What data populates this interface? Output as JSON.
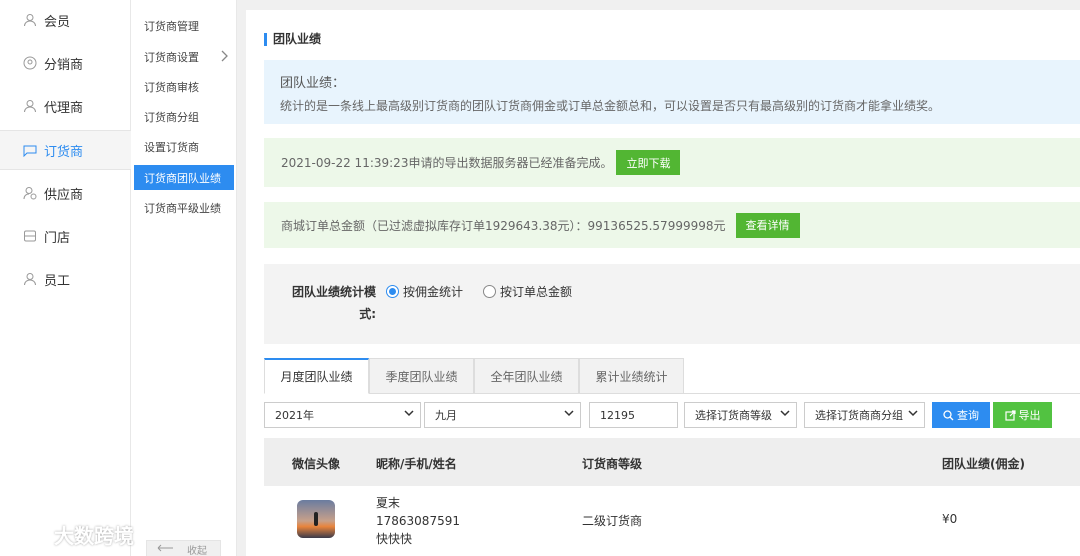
{
  "nav_primary": [
    {
      "label": "会员",
      "icon": "user-icon"
    },
    {
      "label": "分销商",
      "icon": "distributor-icon"
    },
    {
      "label": "代理商",
      "icon": "agent-icon"
    },
    {
      "label": "订货商",
      "icon": "order-icon",
      "active": true
    },
    {
      "label": "供应商",
      "icon": "supplier-icon"
    },
    {
      "label": "门店",
      "icon": "store-icon"
    },
    {
      "label": "员工",
      "icon": "staff-icon"
    }
  ],
  "nav_secondary": [
    {
      "label": "订货商管理"
    },
    {
      "label": "订货商设置",
      "has_submenu": true
    },
    {
      "label": "订货商审核"
    },
    {
      "label": "订货商分组"
    },
    {
      "label": "设置订货商"
    },
    {
      "label": "订货商团队业绩",
      "active": true
    },
    {
      "label": "订货商平级业绩"
    }
  ],
  "collapse_label": "收起",
  "page": {
    "title": "团队业绩",
    "info_title": "团队业绩：",
    "info_text": "统计的是一条线上最高级别订货商的团队订货商佣金或订单总金额总和，可以设置是否只有最高级别的订货商才能拿业绩奖。",
    "export_notice": "2021-09-22 11:39:23申请的导出数据服务器已经准备完成。",
    "export_button": "立即下载",
    "total_notice": "商城订单总金额（已过滤虚拟库存订单1929643.38元）：99136525.57999998元",
    "detail_button": "查看详情",
    "mode_label": "团队业绩统计模式:",
    "mode_options": [
      {
        "label": "按佣金统计",
        "checked": true
      },
      {
        "label": "按订单总金额",
        "checked": false
      }
    ]
  },
  "tabs": [
    {
      "label": "月度团队业绩",
      "active": true
    },
    {
      "label": "季度团队业绩"
    },
    {
      "label": "全年团队业绩"
    },
    {
      "label": "累计业绩统计"
    }
  ],
  "filters": {
    "year": "2021年",
    "month": "九月",
    "keyword": "12195",
    "level_placeholder": "选择订货商等级",
    "group_placeholder": "选择订货商商分组",
    "search_button": "查询",
    "export_button": "导出"
  },
  "table": {
    "headers": [
      "微信头像",
      "昵称/手机/姓名",
      "订货商等级",
      "团队业绩(佣金)"
    ],
    "rows": [
      {
        "nickname": "夏末",
        "phone": "17863087591",
        "name": "快快快",
        "level": "二级订货商",
        "performance": "¥0"
      }
    ]
  },
  "watermark": "大数跨境"
}
